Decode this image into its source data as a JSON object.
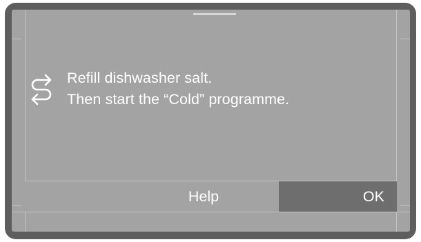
{
  "dialog": {
    "icon": "refill-arrows-icon",
    "message_line1": "Refill dishwasher salt.",
    "message_line2": "Then start the “Cold” programme."
  },
  "buttons": {
    "help_label": "Help",
    "ok_label": "OK"
  },
  "colors": {
    "bezel": "#5e5e5e",
    "screen": "#a3a3a4",
    "selected_button": "#6e6e6e",
    "text": "#ffffff"
  }
}
